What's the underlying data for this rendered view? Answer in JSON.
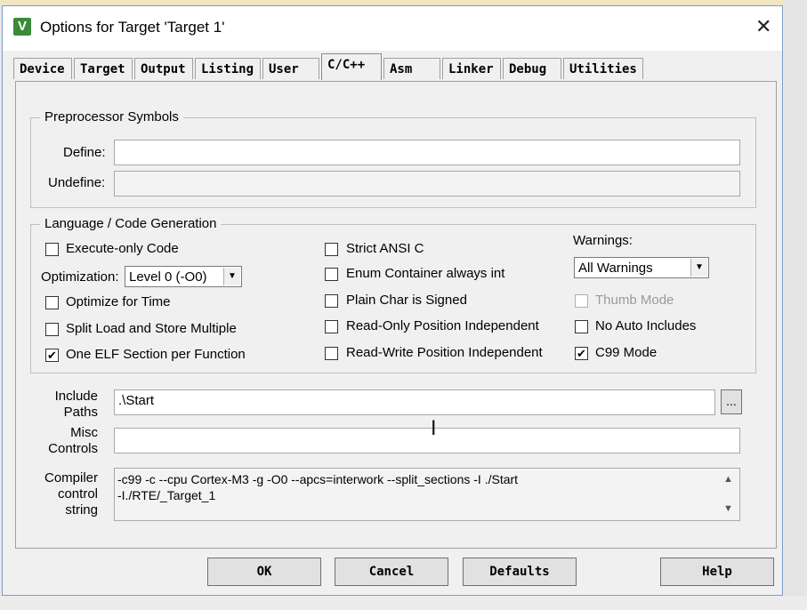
{
  "window": {
    "title": "Options for Target 'Target 1'",
    "icon": "keil-v-icon",
    "close_glyph": "✕"
  },
  "tabs": [
    {
      "label": "Device"
    },
    {
      "label": "Target"
    },
    {
      "label": "Output"
    },
    {
      "label": "Listing"
    },
    {
      "label": "User"
    },
    {
      "label": "C/C++"
    },
    {
      "label": "Asm"
    },
    {
      "label": "Linker"
    },
    {
      "label": "Debug"
    },
    {
      "label": "Utilities"
    }
  ],
  "active_tab": "C/C++",
  "preprocessor": {
    "group_label": "Preprocessor Symbols",
    "define_label": "Define:",
    "define_value": "",
    "undefine_label": "Undefine:",
    "undefine_value": ""
  },
  "codegen": {
    "group_label": "Language / Code Generation",
    "execute_only": {
      "label": "Execute-only Code",
      "checked": false
    },
    "optimization_label": "Optimization:",
    "optimization_value": "Level 0 (-O0)",
    "optimize_time": {
      "label": "Optimize for Time",
      "checked": false
    },
    "split_load": {
      "label": "Split Load and Store Multiple",
      "checked": false
    },
    "one_elf": {
      "label": "One ELF Section per Function",
      "checked": true
    },
    "strict_ansi": {
      "label": "Strict ANSI C",
      "checked": false
    },
    "enum_container": {
      "label": "Enum Container always int",
      "checked": false
    },
    "plain_char": {
      "label": "Plain Char is Signed",
      "checked": false
    },
    "ro_pos": {
      "label": "Read-Only Position Independent",
      "checked": false
    },
    "rw_pos": {
      "label": "Read-Write Position Independent",
      "checked": false
    },
    "warnings_label": "Warnings:",
    "warnings_value": "All Warnings",
    "thumb_mode": {
      "label": "Thumb Mode",
      "checked": false,
      "disabled": true
    },
    "no_auto_includes": {
      "label": "No Auto Includes",
      "checked": false
    },
    "c99_mode": {
      "label": "C99 Mode",
      "checked": true
    }
  },
  "include_paths": {
    "label_line1": "Include",
    "label_line2": "Paths",
    "value": ".\\Start",
    "browse": "..."
  },
  "misc_controls": {
    "label_line1": "Misc",
    "label_line2": "Controls",
    "value": ""
  },
  "compiler_string": {
    "label_line1": "Compiler",
    "label_line2": "control",
    "label_line3": "string",
    "line1": "-c99 -c --cpu Cortex-M3 -g -O0 --apcs=interwork --split_sections -I ./Start",
    "line2": "-I./RTE/_Target_1"
  },
  "buttons": {
    "ok": "OK",
    "cancel": "Cancel",
    "defaults": "Defaults",
    "help": "Help"
  },
  "check_glyph": "✔"
}
